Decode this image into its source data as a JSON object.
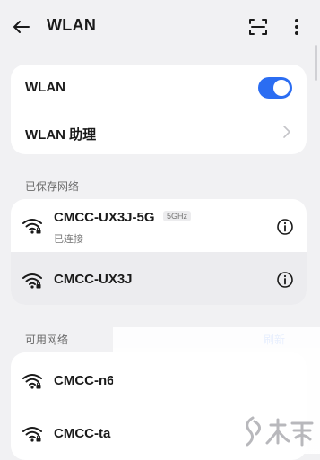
{
  "header": {
    "title": "WLAN",
    "icons": [
      "back-arrow-icon",
      "scan-icon",
      "more-vertical-icon"
    ]
  },
  "settings_card": {
    "wlan_label": "WLAN",
    "wlan_enabled": true,
    "assistant_label": "WLAN 助理"
  },
  "saved_networks": {
    "title": "已保存网络",
    "items": [
      {
        "ssid": "CMCC-UX3J-5G",
        "band": "5GHz",
        "status": "已连接"
      },
      {
        "ssid": "CMCC-UX3J"
      }
    ]
  },
  "available_networks": {
    "title": "可用网络",
    "refresh_label": "刷新",
    "items": [
      {
        "ssid": "CMCC-n6"
      },
      {
        "ssid": "CMCC-ta"
      }
    ]
  },
  "colors": {
    "accent": "#2b6df2",
    "background": "#f1f1f3",
    "card": "#ffffff"
  },
  "watermark": {
    "text": "九游"
  }
}
